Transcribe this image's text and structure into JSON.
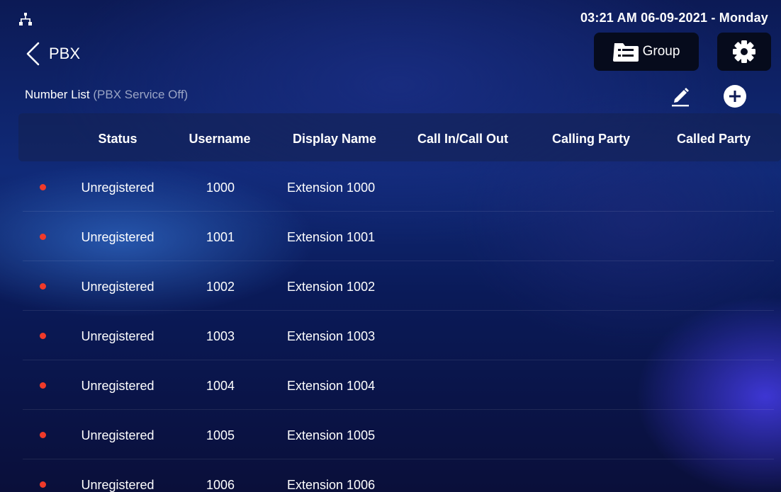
{
  "status_bar": {
    "network_icon": "network-tree-icon",
    "clock": "03:21 AM  06-09-2021 - Monday"
  },
  "header": {
    "back_icon": "chevron-left-icon",
    "title": "PBX",
    "group_button": {
      "label": "Group",
      "icon": "group-list-icon"
    },
    "settings_icon": "gear-icon"
  },
  "list": {
    "title": "Number List",
    "subtitle": "(PBX Service Off)",
    "edit_icon": "pencil-icon",
    "add_icon": "plus-circle-icon"
  },
  "table": {
    "columns": [
      "Status",
      "Username",
      "Display Name",
      "Call In/Call Out",
      "Calling Party",
      "Called Party"
    ],
    "rows": [
      {
        "status": "Unregistered",
        "username": "1000",
        "display_name": "Extension 1000"
      },
      {
        "status": "Unregistered",
        "username": "1001",
        "display_name": "Extension 1001"
      },
      {
        "status": "Unregistered",
        "username": "1002",
        "display_name": "Extension 1002"
      },
      {
        "status": "Unregistered",
        "username": "1003",
        "display_name": "Extension 1003"
      },
      {
        "status": "Unregistered",
        "username": "1004",
        "display_name": "Extension 1004"
      },
      {
        "status": "Unregistered",
        "username": "1005",
        "display_name": "Extension 1005"
      },
      {
        "status": "Unregistered",
        "username": "1006",
        "display_name": "Extension 1006"
      }
    ]
  },
  "colors": {
    "status_dot": "#f03a2a",
    "button_bg": "#060b1c",
    "subtitle": "#9aa4c4"
  }
}
